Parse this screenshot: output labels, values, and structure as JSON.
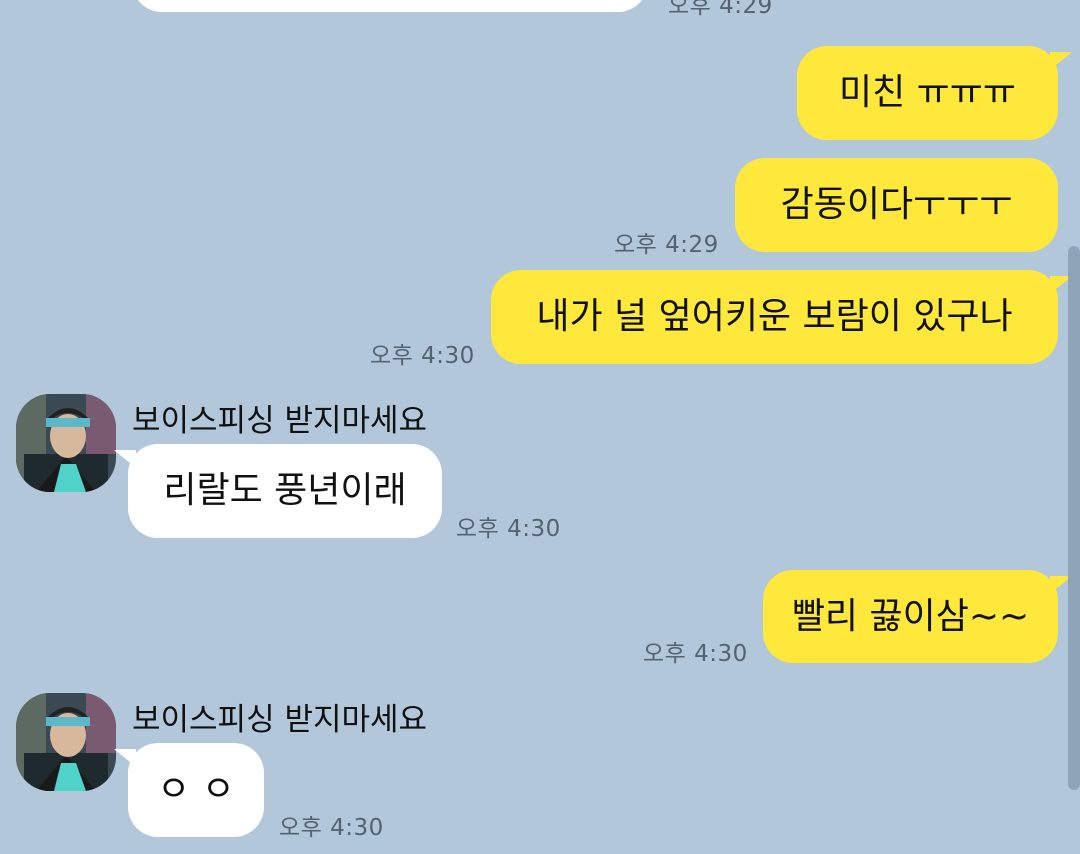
{
  "colors": {
    "background": "#b2c7da",
    "my_bubble": "#fee83c",
    "their_bubble": "#ffffff",
    "timestamp": "#556270"
  },
  "messages": {
    "m0_time": "오후 4:29",
    "m1": "미친 ㅠㅠㅠ",
    "m2": "감동이다ㅜㅜㅜ",
    "m2_time": "오후 4:29",
    "m3": "내가 널 엎어키운 보람이 있구나",
    "m3_time": "오후 4:30",
    "m4_sender": "보이스피싱 받지마세요",
    "m4": "리랄도 풍년이래",
    "m4_time": "오후 4:30",
    "m5": "빨리 끓이삼~~",
    "m5_time": "오후 4:30",
    "m6_sender": "보이스피싱 받지마세요",
    "m6": "ㅇ ㅇ",
    "m6_time": "오후 4:30"
  }
}
